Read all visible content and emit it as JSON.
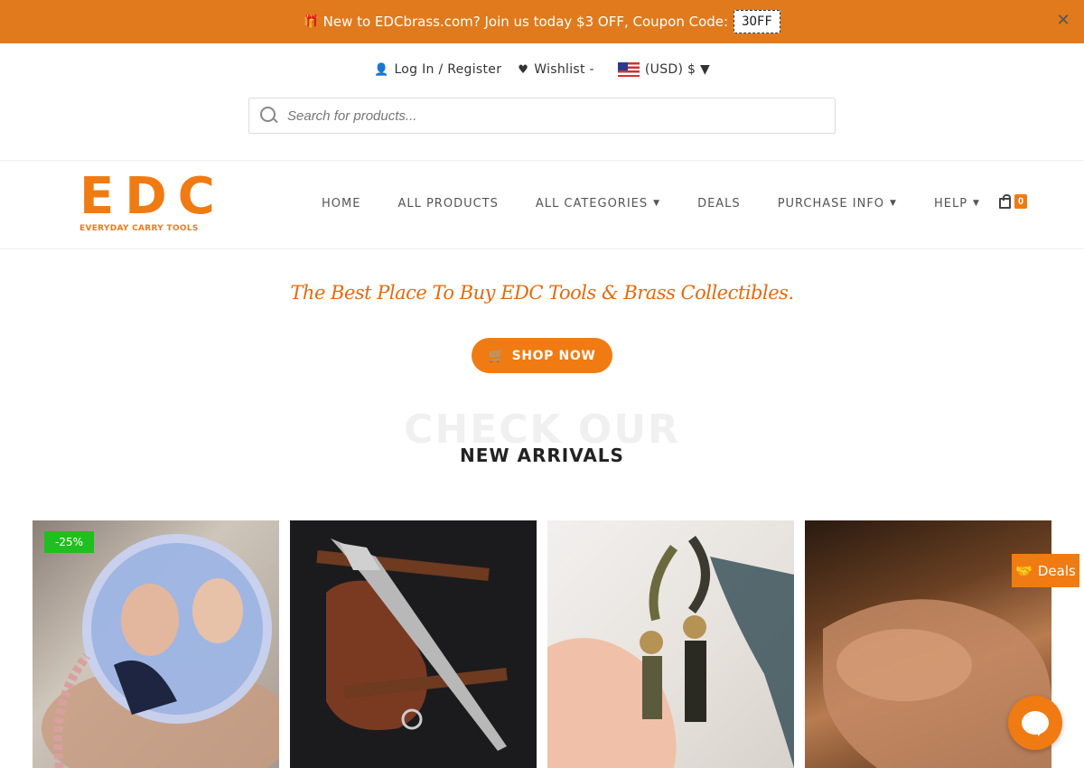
{
  "promo": {
    "text": "New to EDCbrass.com? Join us today $3 OFF, Coupon Code:",
    "coupon": "3OFF",
    "close": "✕"
  },
  "toplinks": {
    "login": "Log In / Register",
    "wishlist": "Wishlist -",
    "currency": "(USD) $ ▼"
  },
  "search": {
    "placeholder": "Search for products..."
  },
  "logo": {
    "main": "EDC",
    "sub": "EVERYDAY CARRY TOOLS"
  },
  "nav": {
    "items": [
      {
        "label": "HOME",
        "caret": ""
      },
      {
        "label": "ALL PRODUCTS",
        "caret": ""
      },
      {
        "label": "ALL CATEGORIES",
        "caret": "⌄"
      },
      {
        "label": "DEALS",
        "caret": ""
      },
      {
        "label": "PURCHASE INFO",
        "caret": "⌄"
      },
      {
        "label": "HELP",
        "caret": "⌄"
      }
    ],
    "cart_count": "0"
  },
  "hero": {
    "tagline": "The Best Place To Buy EDC Tools & Brass Collectibles.",
    "shop_button": "SHOP NOW"
  },
  "section": {
    "bg_title": "CHECK OUR",
    "title": "NEW ARRIVALS"
  },
  "products": [
    {
      "badge": "-25%"
    },
    {
      "badge": ""
    },
    {
      "badge": ""
    },
    {
      "badge": ""
    }
  ],
  "floating": {
    "deals": "Deals"
  },
  "colors": {
    "accent": "#f07b12",
    "promo_bg": "#e07a1c",
    "badge_green": "#1fbf1f"
  }
}
